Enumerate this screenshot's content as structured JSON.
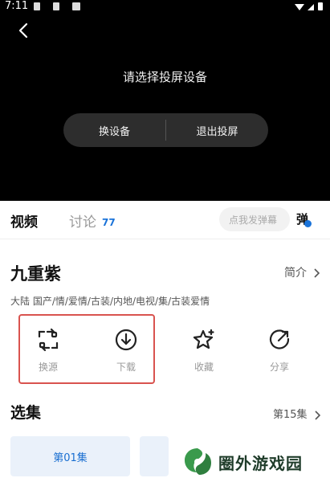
{
  "status_bar": {
    "time": "7:11"
  },
  "player": {
    "cast_prompt": "请选择投屏设备",
    "switch_device_label": "换设备",
    "exit_cast_label": "退出投屏"
  },
  "tabs": {
    "video_label": "视频",
    "discuss_label": "讨论",
    "discuss_count": "77",
    "danmaku_placeholder": "点我发弹幕",
    "danmaku_toggle": "弹"
  },
  "show": {
    "title": "九重紫",
    "intro_label": "简介",
    "tags": "大陆 国产/情/爱情/古装/内地/电视/集/古装爱情"
  },
  "actions": [
    {
      "label": "换源",
      "icon": "switch-source-icon"
    },
    {
      "label": "下载",
      "icon": "download-icon"
    },
    {
      "label": "收藏",
      "icon": "star-icon"
    },
    {
      "label": "分享",
      "icon": "share-icon"
    }
  ],
  "episodes": {
    "title": "选集",
    "count_label": "第15集",
    "items": [
      "第01集",
      ""
    ]
  },
  "watermark": {
    "text": "圈外游戏园"
  },
  "colors": {
    "accent": "#1a73d9",
    "highlight": "#d9534f",
    "episode_bg": "#eaf1fa"
  }
}
